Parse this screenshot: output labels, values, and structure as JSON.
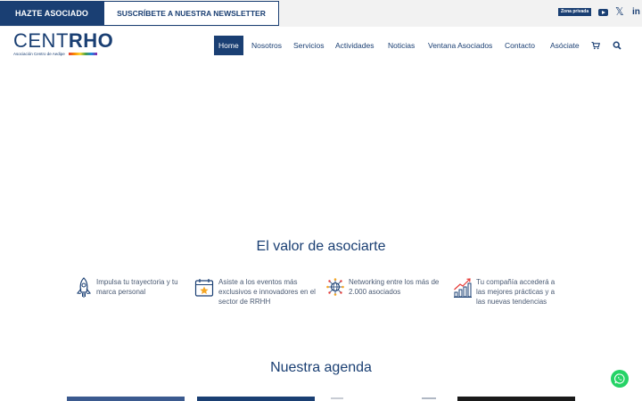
{
  "topbar": {
    "join_label": "HAZTE ASOCIADO",
    "newsletter_label": "SUSCRÍBETE A NUESTRA NEWSLETTER",
    "private_zone_label": "Zona privada",
    "social_icons": [
      "youtube-icon",
      "x-icon",
      "linkedin-icon"
    ]
  },
  "logo": {
    "word_plain": "CENT",
    "word_bold": "RHO",
    "subtitle": "Asociación Centro de Aedipe"
  },
  "nav": {
    "items": [
      {
        "label": "Home",
        "active": true
      },
      {
        "label": "Nosotros",
        "active": false
      },
      {
        "label": "Servicios",
        "active": false
      },
      {
        "label": "Actividades",
        "active": false
      },
      {
        "label": "Noticias",
        "active": false
      },
      {
        "label": "Ventana Asociados",
        "active": false
      },
      {
        "label": "Contacto",
        "active": false
      },
      {
        "label": "Asóciate",
        "active": false
      }
    ],
    "icons": [
      "cart-icon",
      "search-icon"
    ]
  },
  "valor": {
    "title": "El valor de asociarte",
    "benefits": [
      {
        "icon": "rocket-icon",
        "lines": [
          "Impulsa tu trayectoria y tu",
          "marca personal"
        ]
      },
      {
        "icon": "calendar-star-icon",
        "lines": [
          "Asiste a los eventos más",
          "exclusivos e innovadores en el",
          "sector de RRHH"
        ]
      },
      {
        "icon": "network-globe-icon",
        "lines": [
          "Networking entre los más de",
          "2.000 asociados"
        ]
      },
      {
        "icon": "growth-chart-icon",
        "lines": [
          "Tu compañía accederá a",
          "las mejores prácticas y a",
          "las nuevas tendencias"
        ]
      }
    ]
  },
  "agenda": {
    "title": "Nuestra agenda"
  },
  "colors": {
    "brand_navy": "#1a3f73",
    "topbar_bg": "#f2f2f2",
    "whatsapp_green": "#25d366"
  }
}
